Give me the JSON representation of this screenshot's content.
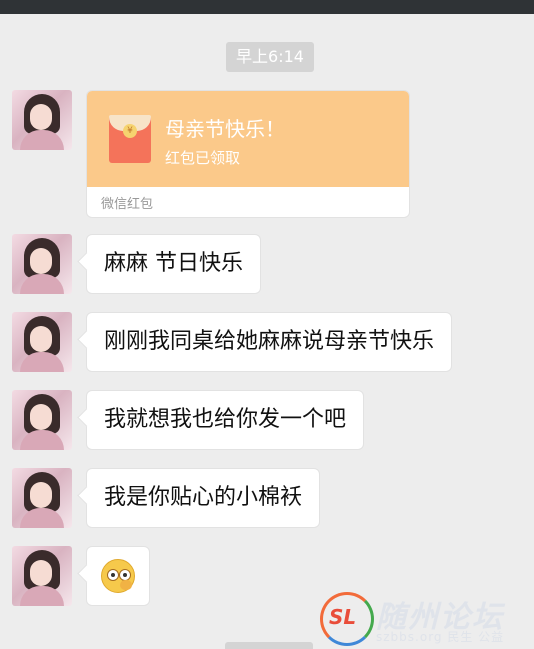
{
  "chat": {
    "timestamp": "早上6:14",
    "red_packet": {
      "title": "母亲节快乐！",
      "status": "红包已领取",
      "label": "微信红包"
    },
    "messages": [
      {
        "text": "麻麻 节日快乐"
      },
      {
        "text": "刚刚我同桌给她麻麻说母亲节快乐"
      },
      {
        "text": "我就想我也给你发一个吧"
      },
      {
        "text": "我是你贴心的小棉袄"
      }
    ],
    "last_message_icon": "blushing-emoji-icon",
    "coin_glyph": "¥"
  },
  "watermark": {
    "logo": "SL",
    "title": "随州论坛",
    "subtitle": "szbbs.org 民生 公益"
  },
  "colors": {
    "background": "#ededed",
    "red_packet_orange": "#fbc98a",
    "envelope_red": "#f4735a"
  }
}
